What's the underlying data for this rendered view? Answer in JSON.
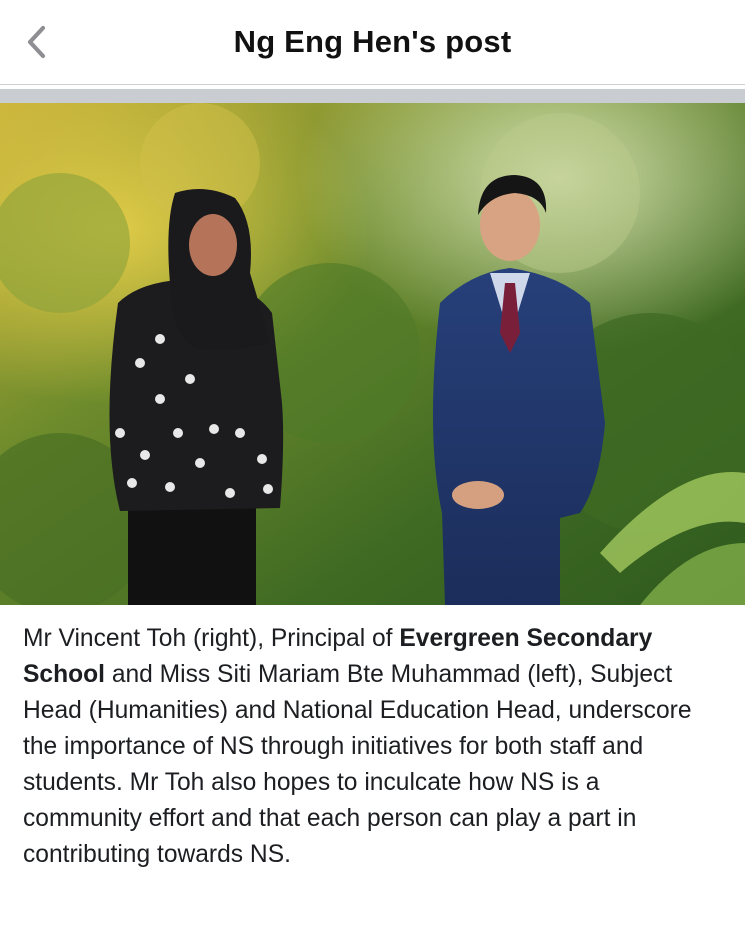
{
  "header": {
    "title": "Ng Eng Hen's post",
    "back_icon": "chevron-left-icon"
  },
  "post": {
    "photo": {
      "description_icon": "photo-two-people-garden"
    },
    "caption": {
      "part1": "Mr Vincent Toh (right), Principal of ",
      "bold1": "Evergreen Secondary School",
      "part2": " and Miss Siti Mariam Bte Muhammad (left), Subject Head (Humanities) and National Education Head, underscore the importance of NS through initiatives for both staff and students. Mr Toh also hopes to inculcate how NS is a community effort and that each person can play a part in contributing towards NS."
    }
  },
  "colors": {
    "divider": "#c9ccd1",
    "text": "#1c1e21",
    "back_icon": "#8e8e93"
  }
}
